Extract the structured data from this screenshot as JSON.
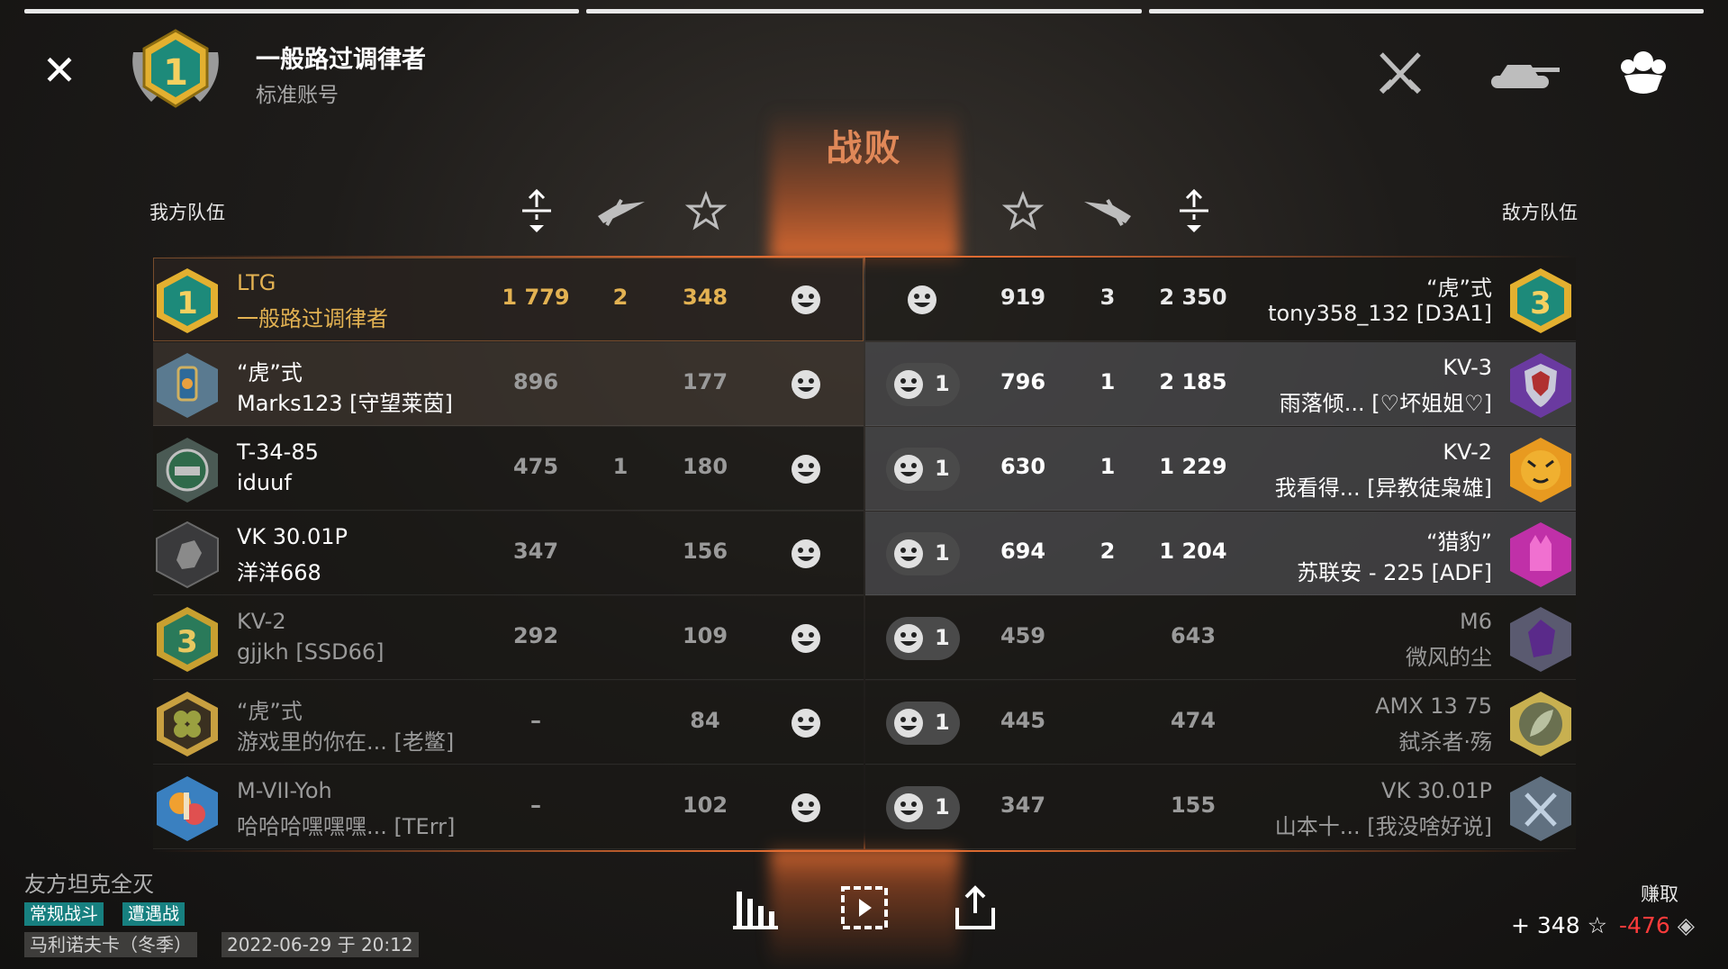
{
  "header": {
    "player_name": "一般路过调律者",
    "account_type": "标准账号",
    "result": "战败",
    "icons": [
      "close-icon",
      "crossed-swords-icon",
      "tank-icon",
      "players-icon"
    ]
  },
  "teams": {
    "ally_label": "我方队伍",
    "enemy_label": "敌方队伍"
  },
  "ally": [
    {
      "vehicle": "LTG",
      "player": "一般路过调律者",
      "clan": "",
      "damage": "1 779",
      "kills": "2",
      "xp": "348",
      "badge": "rank-1"
    },
    {
      "vehicle": "“虎”式",
      "player": "Marks123",
      "clan": "[守望莱茵]",
      "damage": "896",
      "kills": "",
      "xp": "177",
      "badge": "lantern"
    },
    {
      "vehicle": "T-34-85",
      "player": "iduuf",
      "clan": "",
      "damage": "475",
      "kills": "1",
      "xp": "180",
      "badge": "tank-emblem"
    },
    {
      "vehicle": "VK 30.01P",
      "player": "洋洋668",
      "clan": "",
      "damage": "347",
      "kills": "",
      "xp": "156",
      "badge": "stone"
    },
    {
      "vehicle": "KV-2",
      "player": "gjjkh",
      "clan": "[SSD66]",
      "damage": "292",
      "kills": "",
      "xp": "109",
      "badge": "rank-3"
    },
    {
      "vehicle": "“虎”式",
      "player": "游戏里的你在...",
      "clan": "[老鳖]",
      "damage": "–",
      "kills": "",
      "xp": "84",
      "badge": "clover"
    },
    {
      "vehicle": "M-VII-Yoh",
      "player": "哈哈哈嘿嘿嘿...",
      "clan": "[TErr]",
      "damage": "–",
      "kills": "",
      "xp": "102",
      "badge": "colorful"
    }
  ],
  "enemy": [
    {
      "vehicle": "“虎”式",
      "player": "tony358_132",
      "clan": "[D3A1]",
      "damage": "2 350",
      "kills": "3",
      "xp": "919",
      "likes": "",
      "badge": "rank-3"
    },
    {
      "vehicle": "KV-3",
      "player": "雨落倾...",
      "clan": "[♡坏姐姐♡]",
      "damage": "2 185",
      "kills": "1",
      "xp": "796",
      "likes": "1",
      "badge": "purple-shield"
    },
    {
      "vehicle": "KV-2",
      "player": "我看得...",
      "clan": "[异教徒枭雄]",
      "damage": "1 229",
      "kills": "1",
      "xp": "630",
      "likes": "1",
      "badge": "tiger"
    },
    {
      "vehicle": "“猎豹”",
      "player": "苏联安 - 225",
      "clan": "[ADF]",
      "damage": "1 204",
      "kills": "2",
      "xp": "694",
      "likes": "1",
      "badge": "pink-cat"
    },
    {
      "vehicle": "M6",
      "player": "微风的尘",
      "clan": "",
      "damage": "643",
      "kills": "",
      "xp": "459",
      "likes": "1",
      "badge": "purple-gem"
    },
    {
      "vehicle": "AMX 13 75",
      "player": "弑杀者·殇",
      "clan": "",
      "damage": "474",
      "kills": "",
      "xp": "445",
      "likes": "1",
      "badge": "leaf"
    },
    {
      "vehicle": "VK 30.01P",
      "player": "山本十...",
      "clan": "[我没啥好说]",
      "damage": "155",
      "kills": "",
      "xp": "347",
      "likes": "1",
      "badge": "swords"
    }
  ],
  "footer": {
    "message": "友方坦克全灭",
    "tags": [
      "常规战斗",
      "遭遇战"
    ],
    "map": "马利诺夫卡（冬季）",
    "datetime": "2022-06-29 于 20:12",
    "earn_label": "赚取",
    "earn_xp": "+ 348",
    "earn_credits": "-476"
  },
  "colors": {
    "accent": "#e3b252",
    "result": "#e08858",
    "tag": "#178080",
    "loss": "#ff3b3b"
  }
}
